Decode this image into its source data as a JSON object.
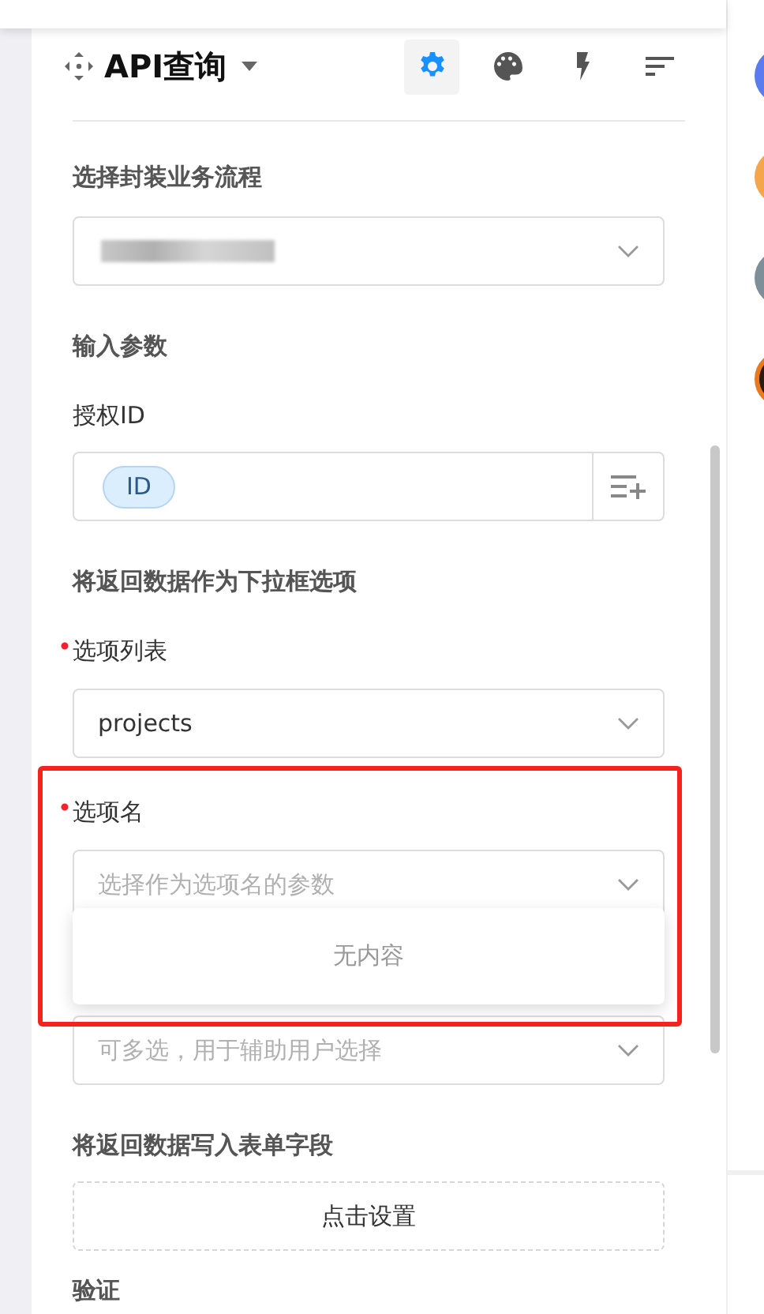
{
  "header": {
    "title": "API查询"
  },
  "toolbar": [
    {
      "kind": "settings",
      "selected": true
    },
    {
      "kind": "palette",
      "selected": false
    },
    {
      "kind": "bolt",
      "selected": false
    },
    {
      "kind": "sort",
      "selected": false
    }
  ],
  "blocks": [
    {
      "kind": "heading",
      "text": "选择封装业务流程"
    },
    {
      "kind": "redacted-select"
    },
    {
      "kind": "heading",
      "text": "输入参数"
    },
    {
      "kind": "label",
      "text": "授权ID",
      "required": false
    },
    {
      "kind": "tag-input",
      "tags": [
        "ID"
      ]
    },
    {
      "kind": "heading",
      "text": "将返回数据作为下拉框选项"
    },
    {
      "kind": "label",
      "text": "选项列表",
      "required": true
    },
    {
      "kind": "select",
      "value": "projects"
    },
    {
      "kind": "label",
      "text": "选项名",
      "required": true,
      "highlighted": true
    },
    {
      "kind": "select",
      "placeholder": "选择作为选项名的参数",
      "open": true,
      "empty_text": "无内容"
    },
    {
      "kind": "covered-select",
      "placeholder": "可多选，用于辅助用户选择"
    },
    {
      "kind": "heading",
      "text": "将返回数据写入表单字段"
    },
    {
      "kind": "dashed-button",
      "text": "点击设置"
    },
    {
      "kind": "heading",
      "text": "验证"
    }
  ]
}
